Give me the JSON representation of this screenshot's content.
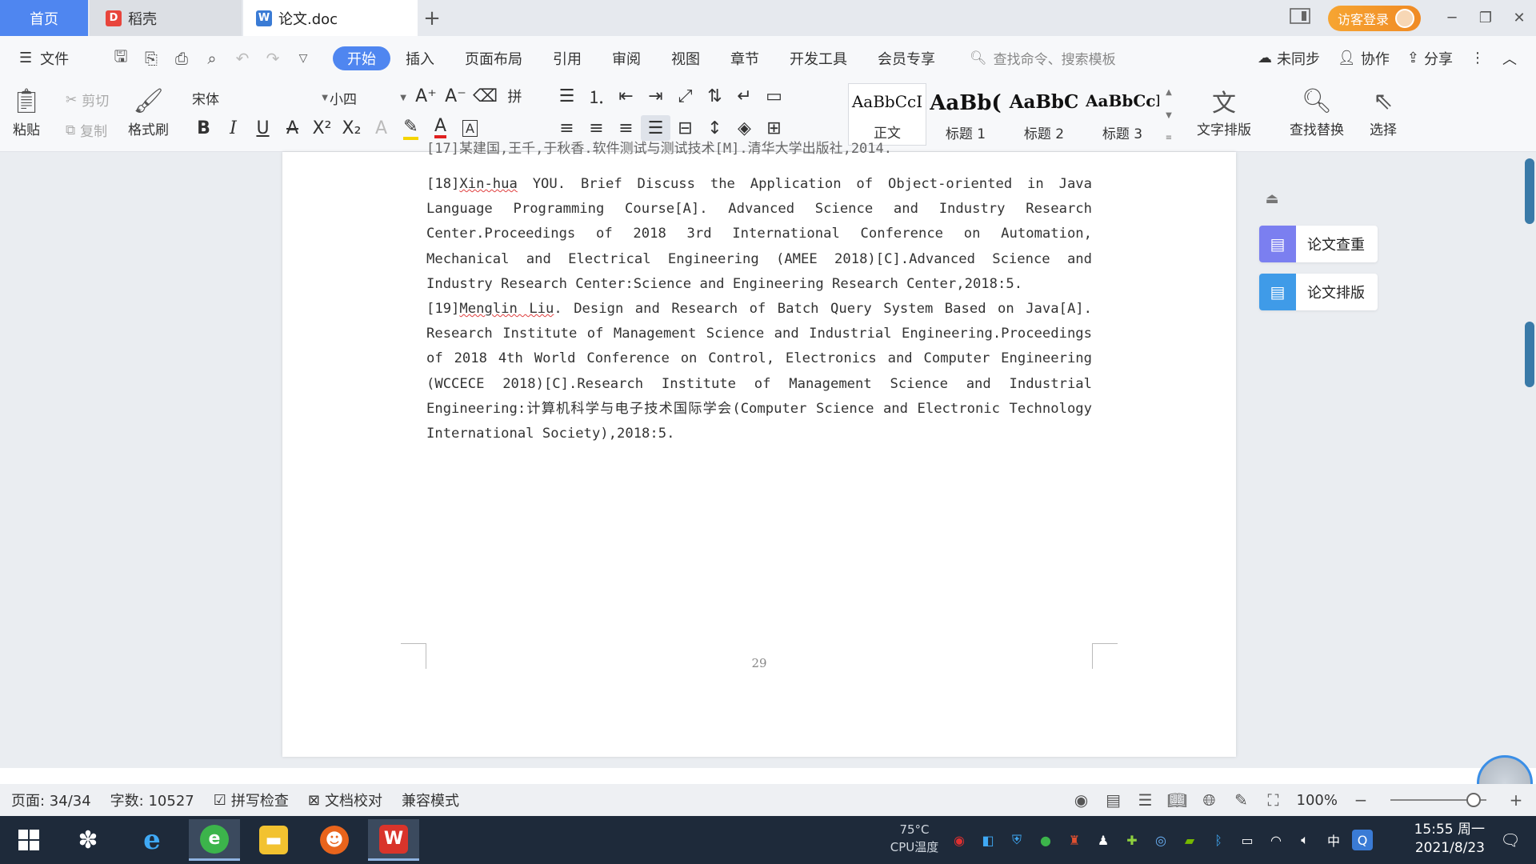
{
  "tabs": {
    "home": "首页",
    "daoke": "稻壳",
    "doc": "论文.doc",
    "add": "+"
  },
  "titlebar": {
    "login": "访客登录"
  },
  "menu": {
    "file": "文件",
    "tabs": [
      "开始",
      "插入",
      "页面布局",
      "引用",
      "审阅",
      "视图",
      "章节",
      "开发工具",
      "会员专享"
    ],
    "search_placeholder": "查找命令、搜索模板",
    "sync": "未同步",
    "collab": "协作",
    "share": "分享"
  },
  "ribbon": {
    "paste": "粘贴",
    "cut": "剪切",
    "copy": "复制",
    "format_painter": "格式刷",
    "font_name": "宋体",
    "font_size": "小四",
    "styles": [
      {
        "sample": "AaBbCcI",
        "name": "正文"
      },
      {
        "sample": "AaBb(",
        "name": "标题 1"
      },
      {
        "sample": "AaBbC",
        "name": "标题 2"
      },
      {
        "sample": "AaBbCcI",
        "name": "标题 3"
      }
    ],
    "text_layout": "文字排版",
    "find_replace": "查找替换",
    "select": "选择"
  },
  "document": {
    "cut_line": "[17]某建国,王千,于秋香.软件测试与测试技术[M].清华大学出版社,2014.",
    "ref18_prefix": "[18]",
    "ref18_name": "Xin-hua",
    "ref18_rest": " YOU. Brief Discuss the Application of Object-oriented in Java Language Programming Course[A]. Advanced Science and Industry Research Center.Proceedings of 2018 3rd International Conference on Automation, Mechanical and Electrical Engineering (AMEE 2018)[C].Advanced Science and Industry Research Center:Science and Engineering Research Center,2018:5.",
    "ref19_prefix": "[19]",
    "ref19_name": "Menglin Liu",
    "ref19_rest": ". Design and Research of Batch Query System Based on Java[A]. Research Institute of Management Science and Industrial Engineering.Proceedings of 2018 4th World Conference on Control, Electronics and Computer Engineering (WCCECE 2018)[C].Research Institute of Management Science and Industrial Engineering:计算机科学与电子技术国际学会(Computer Science and Electronic Technology International Society),2018:5.",
    "page_number": "29"
  },
  "side_panel": {
    "check": "论文查重",
    "layout": "论文排版"
  },
  "status": {
    "page": "页面: 34/34",
    "words": "字数: 10527",
    "spell": "拼写检查",
    "proof": "文档校对",
    "compat": "兼容模式",
    "zoom": "100%"
  },
  "taskbar": {
    "cpu_temp": "75°C",
    "cpu_label": "CPU温度",
    "ime": "中",
    "time": "15:55 周一",
    "date": "2021/8/23"
  },
  "colors": {
    "accent": "#4f86f0",
    "wps_red": "#d9342b",
    "taskbar": "#1e2a3a"
  }
}
